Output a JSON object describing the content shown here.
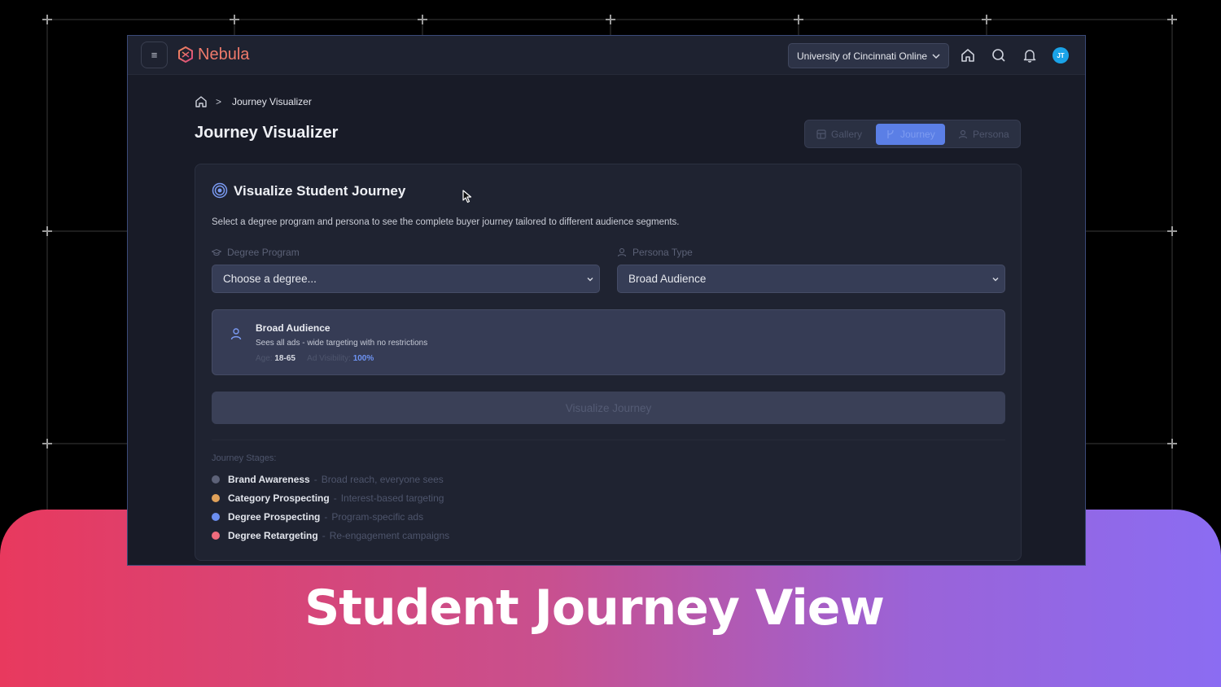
{
  "caption": "Student Journey View",
  "topbar": {
    "menu_glyph": "≡",
    "brand": "Nebula",
    "org_select": "University of Cincinnati Online",
    "avatar_initials": "JT"
  },
  "breadcrumb": {
    "separator": ">",
    "current": "Journey Visualizer"
  },
  "page_title": "Journey Visualizer",
  "tabs": [
    {
      "label": "Gallery",
      "active": false
    },
    {
      "label": "Journey",
      "active": true
    },
    {
      "label": "Persona",
      "active": false
    }
  ],
  "card": {
    "title": "Visualize Student Journey",
    "description": "Select a degree program and persona to see the complete buyer journey tailored to different audience segments.",
    "degree_label": "Degree Program",
    "degree_value": "Choose a degree...",
    "persona_label": "Persona Type",
    "persona_value": "Broad Audience",
    "persona_card": {
      "name": "Broad Audience",
      "description": "Sees all ads - wide targeting with no restrictions",
      "age_label": "Age:",
      "age_value": "18-65",
      "visibility_label": "Ad Visibility:",
      "visibility_value": "100%"
    },
    "visualize_button": "Visualize Journey",
    "stages_title": "Journey Stages:",
    "stages": [
      {
        "name": "Brand Awareness",
        "desc": "Broad reach, everyone sees",
        "color": "#5d6278"
      },
      {
        "name": "Category Prospecting",
        "desc": "Interest-based targeting",
        "color": "#e0a15a"
      },
      {
        "name": "Degree Prospecting",
        "desc": "Program-specific ads",
        "color": "#6b8ef0"
      },
      {
        "name": "Degree Retargeting",
        "desc": "Re-engagement campaigns",
        "color": "#ef6b7d"
      }
    ]
  },
  "colors": {
    "accent": "#5b7fe6",
    "brand": "#ef7a6b",
    "band_start": "#e8395e",
    "band_end": "#8b6cf2"
  }
}
